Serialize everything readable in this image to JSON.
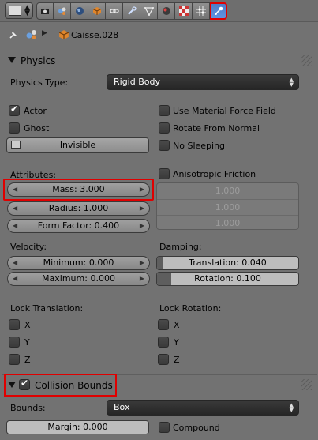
{
  "toolbar": {
    "tabs": [
      {
        "icon": "render-icon"
      },
      {
        "icon": "scene-icon"
      },
      {
        "icon": "world-icon"
      },
      {
        "icon": "object-icon"
      },
      {
        "icon": "constraints-icon"
      },
      {
        "icon": "modifiers-icon"
      },
      {
        "icon": "data-icon"
      },
      {
        "icon": "material-icon"
      },
      {
        "icon": "texture-icon"
      },
      {
        "icon": "particles-icon"
      },
      {
        "icon": "physics-icon"
      }
    ],
    "active_tab": "physics"
  },
  "breadcrumb": {
    "object_name": "Caisse.028"
  },
  "physics": {
    "title": "Physics",
    "physics_type_label": "Physics Type:",
    "physics_type_value": "Rigid Body",
    "actor_label": "Actor",
    "ghost_label": "Ghost",
    "invisible_label": "Invisible",
    "use_material_force_field": "Use Material Force Field",
    "rotate_from_normal": "Rotate From Normal",
    "no_sleeping": "No Sleeping",
    "attributes_label": "Attributes:",
    "mass": "Mass: 3.000",
    "radius": "Radius: 1.000",
    "form_factor": "Form Factor: 0.400",
    "anisotropic_friction": "Anisotropic Friction",
    "friction_values": [
      "1.000",
      "1.000",
      "1.000"
    ],
    "velocity_label": "Velocity:",
    "minimum": "Minimum: 0.000",
    "maximum": "Maximum: 0.000",
    "damping_label": "Damping:",
    "translation": "Translation: 0.040",
    "rotation": "Rotation: 0.100",
    "translation_level": 0.04,
    "rotation_level": 0.1,
    "lock_translation_label": "Lock Translation:",
    "lock_rotation_label": "Lock Rotation:",
    "axes": [
      "X",
      "Y",
      "Z"
    ],
    "actor_checked": true
  },
  "collision": {
    "title": "Collision Bounds",
    "checked": true,
    "bounds_label": "Bounds:",
    "bounds_value": "Box",
    "margin": "Margin: 0.000",
    "compound_label": "Compound"
  },
  "colors": {
    "panel_bg": "#727272",
    "active_tab": "#5f93e0",
    "highlight": "#e00000"
  }
}
